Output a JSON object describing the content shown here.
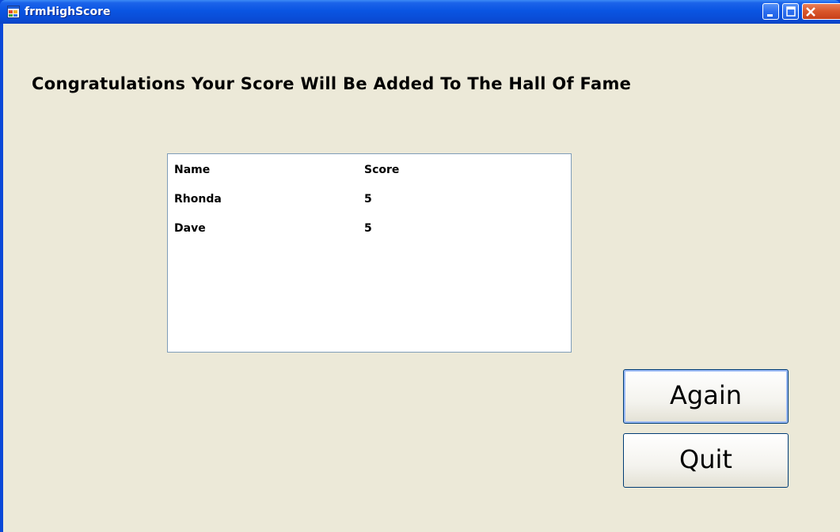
{
  "window": {
    "title": "frmHighScore",
    "icon": "app-window-icon",
    "controls": [
      "minimize-icon",
      "maximize-icon",
      "close-icon"
    ]
  },
  "heading": "Congratulations Your Score Will Be Added To The Hall Of Fame",
  "scores": {
    "header": {
      "name": "Name",
      "score": "Score"
    },
    "rows": [
      {
        "name": "Rhonda",
        "score": "5"
      },
      {
        "name": "Dave",
        "score": "5"
      }
    ]
  },
  "buttons": {
    "again": "Again",
    "quit": "Quit"
  },
  "colors": {
    "titlebar": "#0a55e2",
    "client_background": "#ece9d8",
    "close_button": "#d9562a"
  }
}
